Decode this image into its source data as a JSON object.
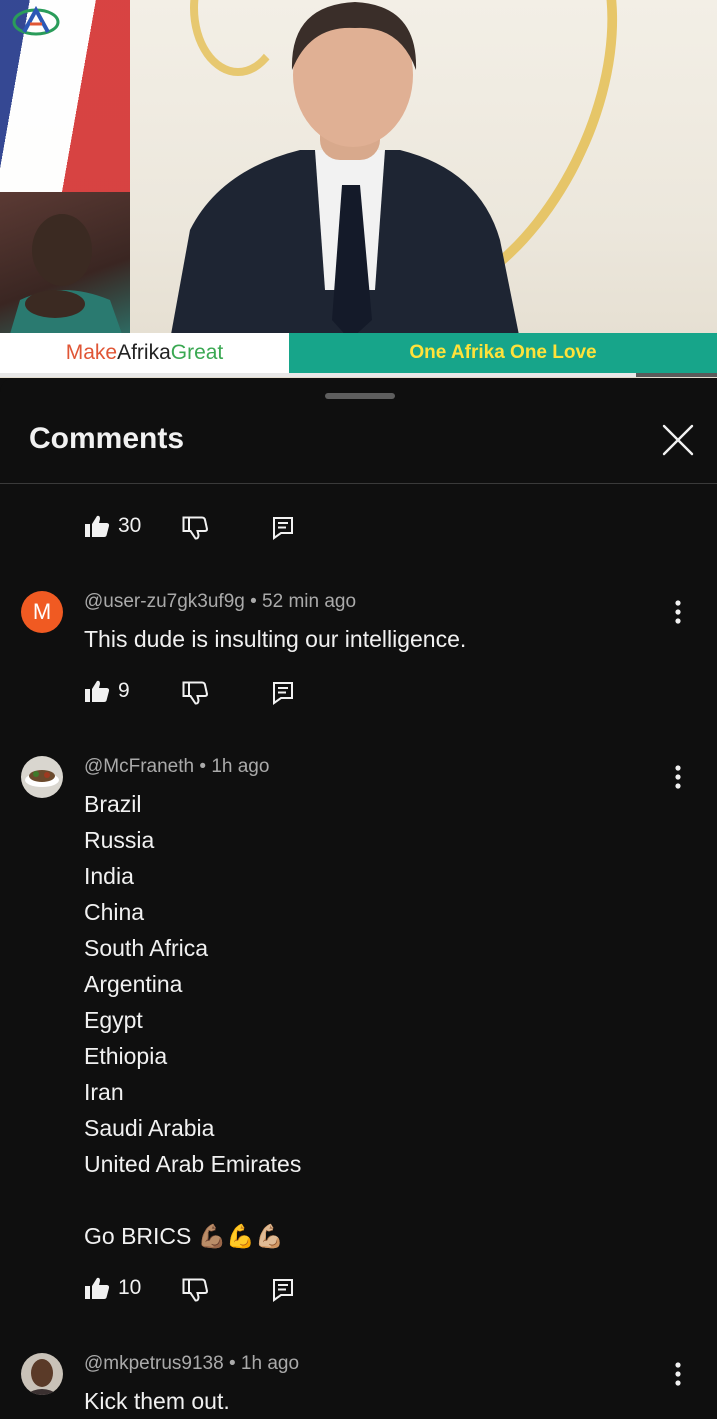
{
  "video": {
    "banner_left": {
      "part1": "Make ",
      "part2": "Afrika ",
      "part3": "Great"
    },
    "banner_right": "One Afrika One Love",
    "progress_fraction": 0.887
  },
  "comments_panel": {
    "title": "Comments",
    "close_icon": "close-icon",
    "top_partial_row": {
      "likes": "30"
    },
    "comments": [
      {
        "avatar_letter": "M",
        "avatar_color": "#f05a22",
        "author": "@user-zu7gk3uf9g",
        "time": "52 min ago",
        "text": "This dude is insulting our intelligence.",
        "likes": "9"
      },
      {
        "author": "@McFraneth",
        "time": "1h ago",
        "text": "Brazil\nRussia\nIndia\nChina\nSouth Africa\nArgentina\nEgypt\nEthiopia\nIran\nSaudi Arabia\nUnited Arab Emirates\n\nGo BRICS 💪🏽💪💪🏼",
        "likes": "10"
      },
      {
        "author": "@mkpetrus9138",
        "time": "1h ago",
        "text": "Kick them out."
      }
    ]
  },
  "colors": {
    "background": "#0f0f0f",
    "text": "#f1f1f1",
    "secondary_text": "#aaaaaa",
    "banner_green": "#17a58a",
    "banner_yellow": "#ffe23a"
  }
}
